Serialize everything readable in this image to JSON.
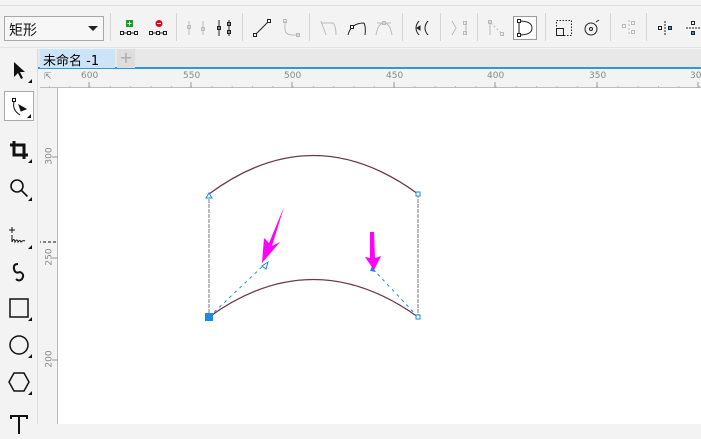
{
  "property_bar": {
    "shape_dropdown": "矩形",
    "buttons": [
      "add-node",
      "delete-node",
      "join-nodes",
      "break-curve",
      "to-line",
      "to-curve",
      "cusp-node",
      "smooth-node",
      "symmetrical-node",
      "reverse-direction",
      "extract-subpath",
      "extend-curve-to-close",
      "close-curve",
      "stretch-scale-nodes",
      "rotate-skew-nodes",
      "align-nodes",
      "mirror-horizontal",
      "mirror-vertical"
    ],
    "active_button": "close-curve"
  },
  "tabs": {
    "document": "未命名 -1",
    "add": "+"
  },
  "ruler": {
    "unit_icon": "⇱",
    "horizontal": [
      "600",
      "550",
      "500",
      "450",
      "400",
      "350",
      "300"
    ],
    "vertical": [
      "300",
      "250",
      "200"
    ]
  },
  "toolbox": [
    "pick",
    "shape",
    "crop",
    "zoom",
    "freehand",
    "artistic-media",
    "rectangle",
    "ellipse",
    "polygon",
    "text"
  ],
  "active_tool": "shape",
  "colors": {
    "accent": "#2a9ad8",
    "tab": "#cce4f7",
    "annotation": "#ff00ff",
    "node": "#1e88e5"
  }
}
